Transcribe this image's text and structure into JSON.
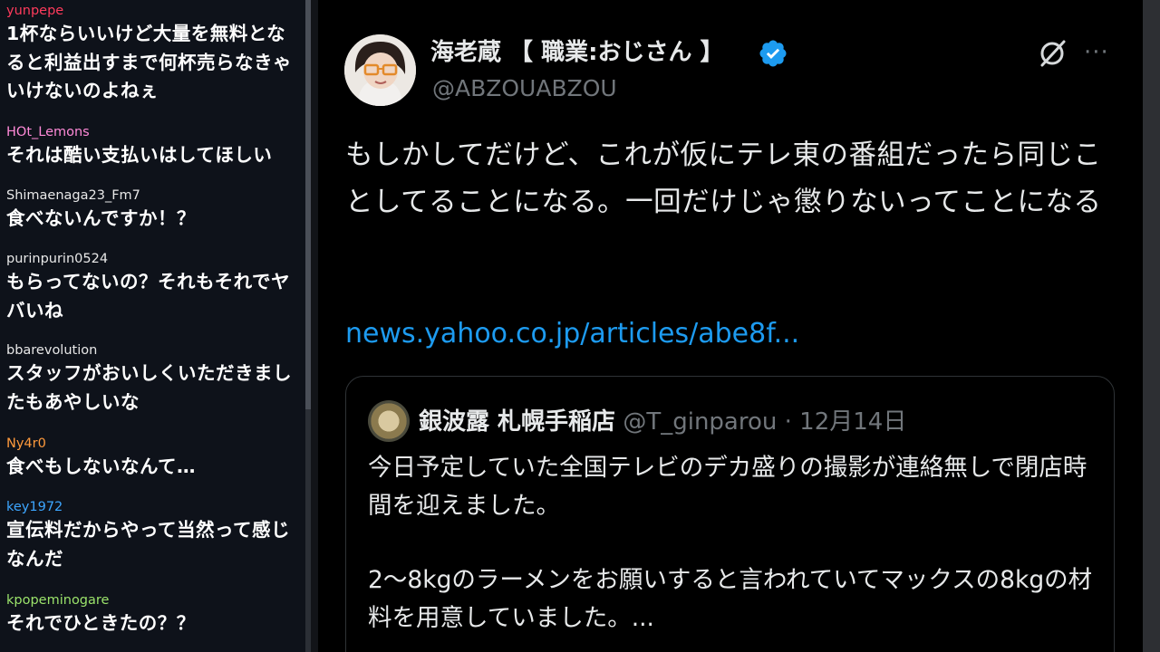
{
  "chat": {
    "messages": [
      {
        "user": "yunpepe",
        "user_color": "#ff3b5c",
        "text": "1杯ならいいけど大量を無料となると利益出すまで何杯売らなきゃいけないのよねぇ"
      },
      {
        "user": "HOt_Lemons",
        "user_color": "#ff8ad8",
        "text": "それは酷い支払いはしてほしい"
      },
      {
        "user": "Shimaenaga23_Fm7",
        "user_color": "#e8e8e8",
        "text": "食べないんですか！？"
      },
      {
        "user": "purinpurin0524",
        "user_color": "#e8e8e8",
        "text": "もらってないの？それもそれでヤバいね"
      },
      {
        "user": "bbarevolution",
        "user_color": "#e8e8e8",
        "text": "スタッフがおいしくいただきましたもあやしいな"
      },
      {
        "user": "Ny4r0",
        "user_color": "#ff9a3c",
        "text": "食べもしないなんて…"
      },
      {
        "user": "key1972",
        "user_color": "#3da6ff",
        "text": "宣伝料だからやって当然って感じなんだ"
      },
      {
        "user": "kpopeminogare",
        "user_color": "#9be36b",
        "text": "それでひときたの？？"
      }
    ]
  },
  "tweet": {
    "display_name": "海老蔵 【 職業:おじさん 】",
    "handle": "@ABZOUABZOU",
    "body": "もしかしてだけど、これが仮にテレ東の番組だったら同じことしてることになる。一回だけじゃ懲りないってことになる",
    "link": "news.yahoo.co.jp/articles/abe8f...",
    "more_label": "···",
    "verified_color": "#1d9bf0"
  },
  "quote": {
    "name": "銀波露 札幌手稲店",
    "handle": "@T_ginparou",
    "separator": "·",
    "date": "12月14日",
    "line1": "今日予定していた全国テレビのデカ盛りの撮影が連絡無しで閉店時間を迎えました。",
    "line2": "2〜8kgのラーメンをお願いすると言われていてマックスの8kgの材料を用意していました。..."
  }
}
